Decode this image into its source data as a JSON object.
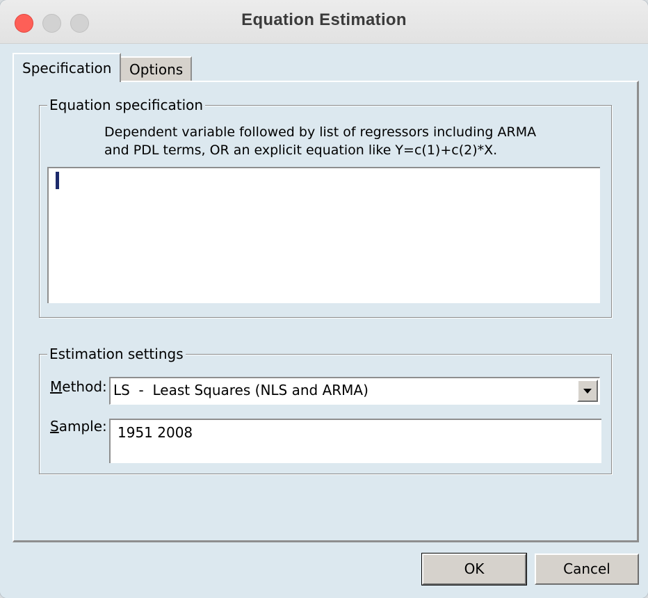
{
  "window": {
    "title": "Equation Estimation"
  },
  "tabs": [
    {
      "label": "Specification",
      "active": true
    },
    {
      "label": "Options",
      "active": false
    }
  ],
  "equation_spec": {
    "legend": "Equation specification",
    "hint": "Dependent variable followed by list of regressors including ARMA\nand PDL terms, OR an explicit equation like Y=c(1)+c(2)*X.",
    "value": ""
  },
  "estimation": {
    "legend": "Estimation settings",
    "method_label_underlined": "M",
    "method_label_rest": "ethod:",
    "method_value": "LS  -  Least Squares (NLS and ARMA)",
    "sample_label_underlined": "S",
    "sample_label_rest": "ample:",
    "sample_value": "1951 2008"
  },
  "buttons": {
    "ok": "OK",
    "cancel": "Cancel"
  },
  "colors": {
    "close": "#fe5f57",
    "dialog_bg": "#dce8ef",
    "button_face": "#d6d2cc",
    "caret": "#1c2a6b"
  }
}
